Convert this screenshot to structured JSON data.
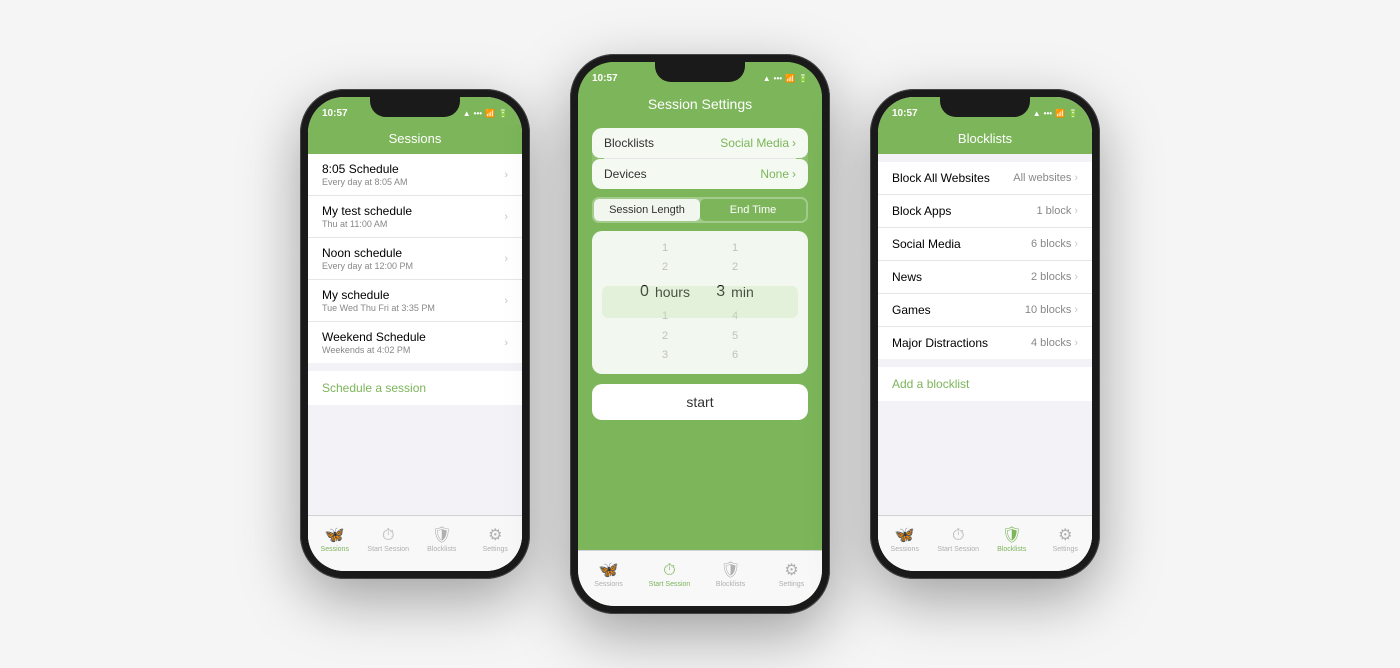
{
  "background": "#f5f5f5",
  "phone1": {
    "status": {
      "time": "10:57",
      "icons": "▲ .all 📶 🔋"
    },
    "header": "Sessions",
    "schedules": [
      {
        "title": "8:05 Schedule",
        "subtitle": "Every day at 8:05 AM"
      },
      {
        "title": "My test schedule",
        "subtitle": "Thu at 11:00 AM"
      },
      {
        "title": "Noon schedule",
        "subtitle": "Every day at 12:00 PM"
      },
      {
        "title": "My schedule",
        "subtitle": "Tue Wed Thu Fri at 3:35 PM"
      },
      {
        "title": "Weekend Schedule",
        "subtitle": "Weekends at 4:02 PM"
      }
    ],
    "action_link": "Schedule a session",
    "tabs": [
      {
        "label": "Sessions",
        "active": true,
        "icon": "🦋"
      },
      {
        "label": "Start Session",
        "active": false,
        "icon": "⏱"
      },
      {
        "label": "Blocklists",
        "active": false,
        "icon": "🛡"
      },
      {
        "label": "Settings",
        "active": false,
        "icon": "⚙"
      }
    ]
  },
  "phone2": {
    "status": {
      "time": "10:57",
      "icons": "▲ .all 📶 🔋"
    },
    "header": "Session Settings",
    "blocklists_label": "Blocklists",
    "blocklists_value": "Social Media",
    "devices_label": "Devices",
    "devices_value": "None",
    "segment": {
      "option1": "Session Length",
      "option2": "End Time",
      "active": "option1"
    },
    "picker": {
      "hours_values": [
        "",
        "1",
        "2",
        "0 hours",
        "1",
        "2",
        "3"
      ],
      "hours_selected": "0",
      "hours_label": "hours",
      "mins_values": [
        "1",
        "2",
        "3 min",
        "4",
        "5",
        "6"
      ],
      "mins_selected": "3",
      "mins_label": "min"
    },
    "start_button": "start",
    "tabs": [
      {
        "label": "Sessions",
        "active": false,
        "icon": "🦋"
      },
      {
        "label": "Start Session",
        "active": true,
        "icon": "⏱"
      },
      {
        "label": "Blocklists",
        "active": false,
        "icon": "🛡"
      },
      {
        "label": "Settings",
        "active": false,
        "icon": "⚙"
      }
    ]
  },
  "phone3": {
    "status": {
      "time": "10:57",
      "icons": "▲ .all 📶 🔋"
    },
    "header": "Blocklists",
    "items": [
      {
        "name": "Block All Websites",
        "value": "All websites"
      },
      {
        "name": "Block Apps",
        "value": "1 block"
      },
      {
        "name": "Social Media",
        "value": "6 blocks"
      },
      {
        "name": "News",
        "value": "2 blocks"
      },
      {
        "name": "Games",
        "value": "10 blocks"
      },
      {
        "name": "Major Distractions",
        "value": "4 blocks"
      }
    ],
    "add_link": "Add a blocklist",
    "tabs": [
      {
        "label": "Sessions",
        "active": false,
        "icon": "🦋"
      },
      {
        "label": "Start Session",
        "active": false,
        "icon": "⏱"
      },
      {
        "label": "Blocklists",
        "active": true,
        "icon": "🛡"
      },
      {
        "label": "Settings",
        "active": false,
        "icon": "⚙"
      }
    ]
  }
}
